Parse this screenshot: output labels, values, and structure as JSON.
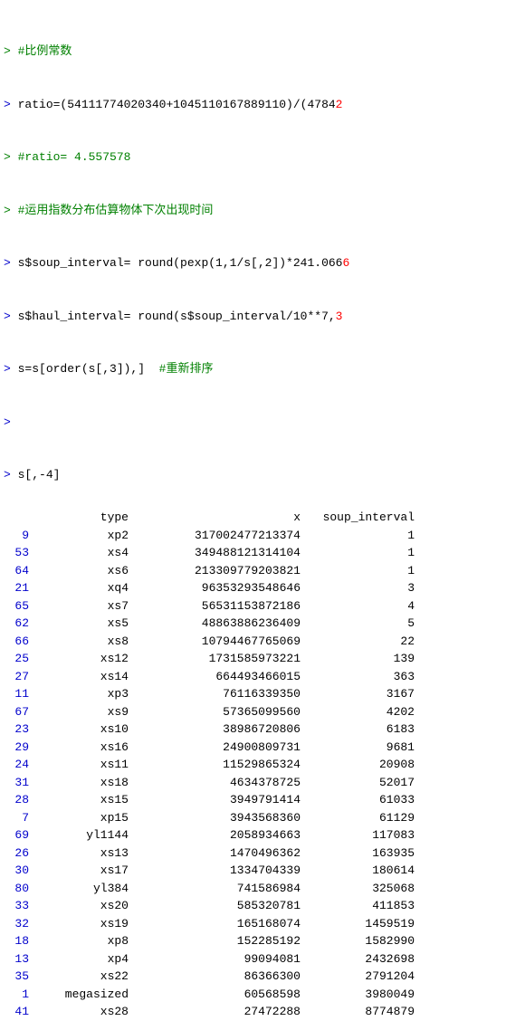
{
  "console": {
    "lines": [
      {
        "type": "comment",
        "text": "> #比例常数"
      },
      {
        "type": "code_prompt",
        "text": "> ratio=(54111774020340+1045110167889110)/(4784"
      },
      {
        "type": "comment_prompt",
        "text": "> #ratio= 4.557578"
      },
      {
        "type": "comment_prompt",
        "text": "> #运用指数分布估算物体下次出现时间"
      },
      {
        "type": "code_prompt",
        "text": "> s$soup_interval= round(pexp(1,1/s[,2])*241.066"
      },
      {
        "type": "code_prompt",
        "text": "> s$haul_interval= round(s$soup_interval/10**7,"
      },
      {
        "type": "code_prompt",
        "text": "> s=s[order(s[,3]),]  #重新排序"
      },
      {
        "type": "blank_prompt",
        "text": ">"
      },
      {
        "type": "code_prompt",
        "text": "> s[,-4]"
      }
    ],
    "table": {
      "headers": [
        "",
        "type",
        "x",
        "soup_interval"
      ],
      "rows": [
        {
          "index": "9",
          "type": "xp2",
          "x": "317002477213374",
          "soup": "1"
        },
        {
          "index": "53",
          "type": "xs4",
          "x": "349488121314104",
          "soup": "1"
        },
        {
          "index": "64",
          "type": "xs6",
          "x": "213309779203821",
          "soup": "1"
        },
        {
          "index": "21",
          "type": "xq4",
          "x": "96353293548646",
          "soup": "3"
        },
        {
          "index": "65",
          "type": "xs7",
          "x": "56531153872186",
          "soup": "4"
        },
        {
          "index": "62",
          "type": "xs5",
          "x": "48863886236409",
          "soup": "5"
        },
        {
          "index": "66",
          "type": "xs8",
          "x": "10794467765069",
          "soup": "22"
        },
        {
          "index": "25",
          "type": "xs12",
          "x": "1731585973221",
          "soup": "139"
        },
        {
          "index": "27",
          "type": "xs14",
          "x": "664493466015",
          "soup": "363"
        },
        {
          "index": "11",
          "type": "xp3",
          "x": "76116339350",
          "soup": "3167"
        },
        {
          "index": "67",
          "type": "xs9",
          "x": "57365099560",
          "soup": "4202"
        },
        {
          "index": "23",
          "type": "xs10",
          "x": "38986720806",
          "soup": "6183"
        },
        {
          "index": "29",
          "type": "xs16",
          "x": "24900809731",
          "soup": "9681"
        },
        {
          "index": "24",
          "type": "xs11",
          "x": "11529865324",
          "soup": "20908"
        },
        {
          "index": "31",
          "type": "xs18",
          "x": "4634378725",
          "soup": "52017"
        },
        {
          "index": "28",
          "type": "xs15",
          "x": "3949791414",
          "soup": "61033"
        },
        {
          "index": "7",
          "type": "xp15",
          "x": "3943568360",
          "soup": "61129"
        },
        {
          "index": "69",
          "type": "yl1144",
          "x": "2058934663",
          "soup": "117083"
        },
        {
          "index": "26",
          "type": "xs13",
          "x": "1470496362",
          "soup": "163935"
        },
        {
          "index": "30",
          "type": "xs17",
          "x": "1334704339",
          "soup": "180614"
        },
        {
          "index": "80",
          "type": "yl384",
          "x": "741586984",
          "soup": "325068"
        },
        {
          "index": "33",
          "type": "xs20",
          "x": "585320781",
          "soup": "411853"
        },
        {
          "index": "32",
          "type": "xs19",
          "x": "165168074",
          "soup": "1459519"
        },
        {
          "index": "18",
          "type": "xp8",
          "x": "152285192",
          "soup": "1582990"
        },
        {
          "index": "13",
          "type": "xp4",
          "x": "99094081",
          "soup": "2432698"
        },
        {
          "index": "35",
          "type": "xs22",
          "x": "86366300",
          "soup": "2791204"
        },
        {
          "index": "1",
          "type": "megasized",
          "x": "60568598",
          "soup": "3980049"
        },
        {
          "index": "41",
          "type": "xs28",
          "x": "27472288",
          "soup": "8774879"
        }
      ]
    }
  }
}
